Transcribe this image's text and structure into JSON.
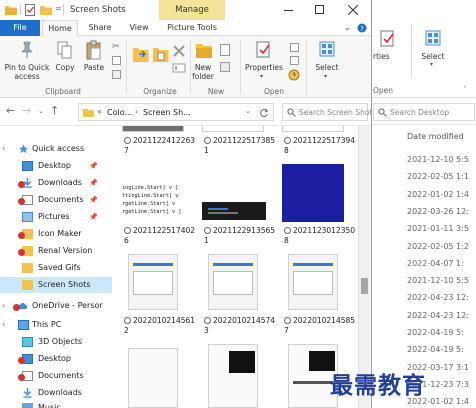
{
  "back_window": {
    "ribbon": {
      "properties_label": "rties",
      "select_label": "Select",
      "open_group": "Open"
    },
    "search_placeholder": "Search Desktop",
    "column_header": "Date modified",
    "dates": [
      "2021-12-10 5:5",
      "2022-02-05 1:1",
      "2022-01-02 1:4",
      "2022-03-26 12:",
      "2021-01-11 3:5",
      "2022-02-05 1:2",
      "2022-04-07 1:",
      "2021-12-10 5:5",
      "2022-04-23 12:",
      "2022-04-23 12:",
      "2022-04-19 5:",
      "2022-04-19 5:",
      "2022-03-17 3:1",
      "2021-12-23 7:3",
      "2022-01-02 1:4",
      "2022-04-07 1:2"
    ]
  },
  "window": {
    "title": "Screen Shots",
    "manage_tab": "Manage",
    "tabs": [
      "File",
      "Home",
      "Share",
      "View",
      "Picture Tools"
    ]
  },
  "ribbon": {
    "pin_to_quick_access": "Pin to Quick access",
    "copy": "Copy",
    "paste": "Paste",
    "new_folder": "New folder",
    "properties": "Properties",
    "select": "Select",
    "groups": [
      "Clipboard",
      "Organize",
      "New",
      "Open"
    ]
  },
  "address": {
    "crumbs": [
      "Colo...",
      "Screen Sh..."
    ],
    "separator": "«"
  },
  "search": {
    "placeholder": "Search Screen Shots"
  },
  "sidebar": {
    "items": [
      {
        "label": "Quick access"
      },
      {
        "label": "Desktop"
      },
      {
        "label": "Downloads"
      },
      {
        "label": "Documents"
      },
      {
        "label": "Pictures"
      },
      {
        "label": "Icon Maker"
      },
      {
        "label": "Renal Version"
      },
      {
        "label": "Saved Gifs"
      },
      {
        "label": "Screen Shots"
      },
      {
        "label": "OneDrive - Persor"
      },
      {
        "label": "This PC"
      },
      {
        "label": "3D Objects"
      },
      {
        "label": "Desktop"
      },
      {
        "label": "Documents"
      },
      {
        "label": "Downloads"
      },
      {
        "label": "Music"
      }
    ]
  },
  "files": {
    "row1": [
      "2021122412263 7",
      "2021122517385 1",
      "2021122517394 8"
    ],
    "row2": [
      "2021122517402 6",
      "2021122913565 1",
      "2021123012350 8"
    ],
    "row3": [
      "2022010214561 2",
      "2022010214574 3",
      "2022010214585 7"
    ]
  },
  "thumb_text": "ingLine.Start[ v ]\nttingLine.Start[ v\nrgetLine.Start[ v\nrgetLine.Start[ v ]",
  "watermark": "最需教育",
  "colors": {
    "accent": "#1e6fc9",
    "manage_tab_bg": "#f3e49a",
    "selected_bg": "#cce8ff",
    "blue_thumb": "#1d1fa3",
    "dark_thumb": "#1b1b1b",
    "watermark": "#1f3f98"
  }
}
